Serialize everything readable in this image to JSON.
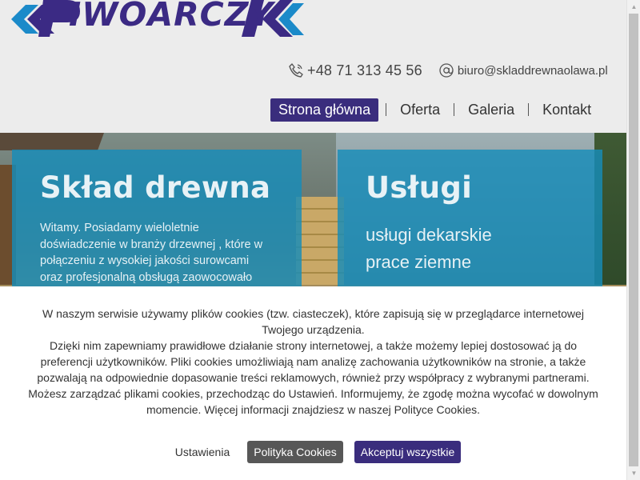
{
  "header": {
    "logo_text": "IWOARCZY",
    "logo_alt": "Piwowarczyk",
    "phone": "+48 71 313 45 56",
    "email": "biuro@skladdrewnaolawa.pl",
    "icons": {
      "phone": "phone-icon",
      "email": "at-sign-icon"
    },
    "nav": [
      {
        "label": "Strona główna",
        "active": true
      },
      {
        "label": "Oferta",
        "active": false
      },
      {
        "label": "Galeria",
        "active": false
      },
      {
        "label": "Kontakt",
        "active": false
      }
    ]
  },
  "hero": {
    "left": {
      "title": "Skład drewna",
      "text": "Witamy. Posiadamy wieloletnie doświadczenie w branży drzewnej , które w połączeniu z wysokiej jakości surowcami oraz profesjonalną obsługą zaowocowało"
    },
    "right": {
      "title": "Usługi",
      "items": [
        "usługi dekarskie",
        "prace ziemne"
      ]
    }
  },
  "cookie": {
    "text": "W naszym serwisie używamy plików cookies (tzw. ciasteczek), które zapisują się w przeglądarce internetowej Twojego urządzenia.\nDzięki nim zapewniamy prawidłowe działanie strony internetowej, a także możemy lepiej dostosować ją do preferencji użytkowników. Pliki cookies umożliwiają nam analizę zachowania użytkowników na stronie, a także pozwalają na odpowiednie dopasowanie treści reklamowych, również przy współpracy z wybranymi partnerami. Możesz zarządzać plikami cookies, przechodząc do Ustawień. Informujemy, że zgodę można wycofać w dowolnym momencie. Więcej informacji znajdziesz w naszej Polityce Cookies.",
    "settings_label": "Ustawienia",
    "policy_label": "Polityka Cookies",
    "accept_label": "Akceptuj wszystkie"
  },
  "colors": {
    "brand_purple": "#3a2d7d",
    "logo_blue": "#1b8ac9",
    "panel_blue": "#168cb9",
    "grey_button": "#575757"
  }
}
